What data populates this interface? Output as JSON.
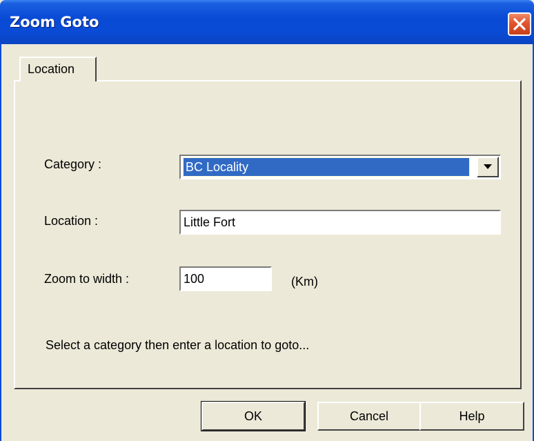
{
  "window": {
    "title": "Zoom Goto"
  },
  "tabs": [
    {
      "label": "Location"
    }
  ],
  "form": {
    "category_label": "Category :",
    "category_value": "BC Locality",
    "location_label": "Location :",
    "location_value": "Little Fort",
    "zoom_label": "Zoom to width :",
    "zoom_value": "100",
    "zoom_unit": "(Km)",
    "hint": "Select a category then enter a location to goto..."
  },
  "buttons": {
    "ok": "OK",
    "cancel": "Cancel",
    "help": "Help"
  },
  "icons": {
    "close": "close-icon",
    "dropdown": "chevron-down-icon"
  },
  "colors": {
    "titlebar": "#0a4bd6",
    "selection": "#316ac5",
    "close": "#e0552d",
    "face": "#ece9d8"
  }
}
